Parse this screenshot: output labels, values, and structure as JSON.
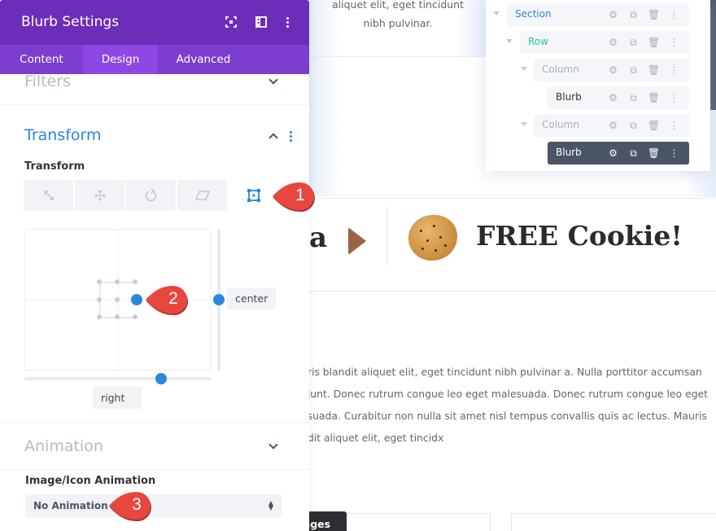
{
  "background_page": {
    "top_text_line1": "aliquet elit, eget tincidunt",
    "top_text_line2": "nibh pulvinar.",
    "promo_letter": "a",
    "promo_headline": "FREE Cookie!",
    "body_lines": [
      "uris blandit aliquet elit, eget tincidunt nibh pulvinar a. Nulla porttitor accumsan",
      "idunt. Donec rutrum congue leo eget malesuada. Donec rutrum congue leo eget",
      "esuada. Curabitur non nulla sit amet nisl tempus convallis quis ac lectus. Mauris",
      "ndit aliquet elit, eget tincidx"
    ],
    "save_button_partial": "hanges"
  },
  "layers": {
    "items": [
      {
        "label": "Section",
        "color": "#2b87da",
        "active": false
      },
      {
        "label": "Row",
        "color": "#29c4a9",
        "active": false
      },
      {
        "label": "Column",
        "color": "#a8b0bb",
        "active": false
      },
      {
        "label": "Blurb",
        "color": "#333333",
        "active": false
      },
      {
        "label": "Column",
        "color": "#a8b0bb",
        "active": false
      },
      {
        "label": "Blurb",
        "color": "#ffffff",
        "active": true
      }
    ],
    "tool_icons": [
      "gear-icon",
      "duplicate-icon",
      "trash-icon",
      "more-icon"
    ]
  },
  "panel": {
    "title": "Blurb Settings",
    "header_icons": [
      "fullscreen-icon",
      "split-view-icon",
      "more-icon"
    ],
    "tabs": [
      {
        "label": "Content",
        "active": false
      },
      {
        "label": "Design",
        "active": true
      },
      {
        "label": "Advanced",
        "active": false
      }
    ],
    "filters_title": "Filters",
    "transform_title": "Transform",
    "transform_label": "Transform",
    "transform_buttons": [
      {
        "name": "scale-icon",
        "active": false
      },
      {
        "name": "translate-icon",
        "active": false
      },
      {
        "name": "rotate-icon",
        "active": false
      },
      {
        "name": "skew-icon",
        "active": false
      },
      {
        "name": "origin-icon",
        "active": true
      }
    ],
    "origin_vertical": "center",
    "origin_horizontal": "right",
    "animation_title": "Animation",
    "animation_field_label": "Image/Icon Animation",
    "animation_value": "No Animation"
  },
  "colors": {
    "header_purple": "#6c2eb9",
    "tabs_purple": "#7b3ecf",
    "active_tab": "#8e47e5",
    "accent_blue": "#2b87da",
    "marker_red": "#e8473e"
  },
  "markers": [
    "1",
    "2",
    "3"
  ]
}
